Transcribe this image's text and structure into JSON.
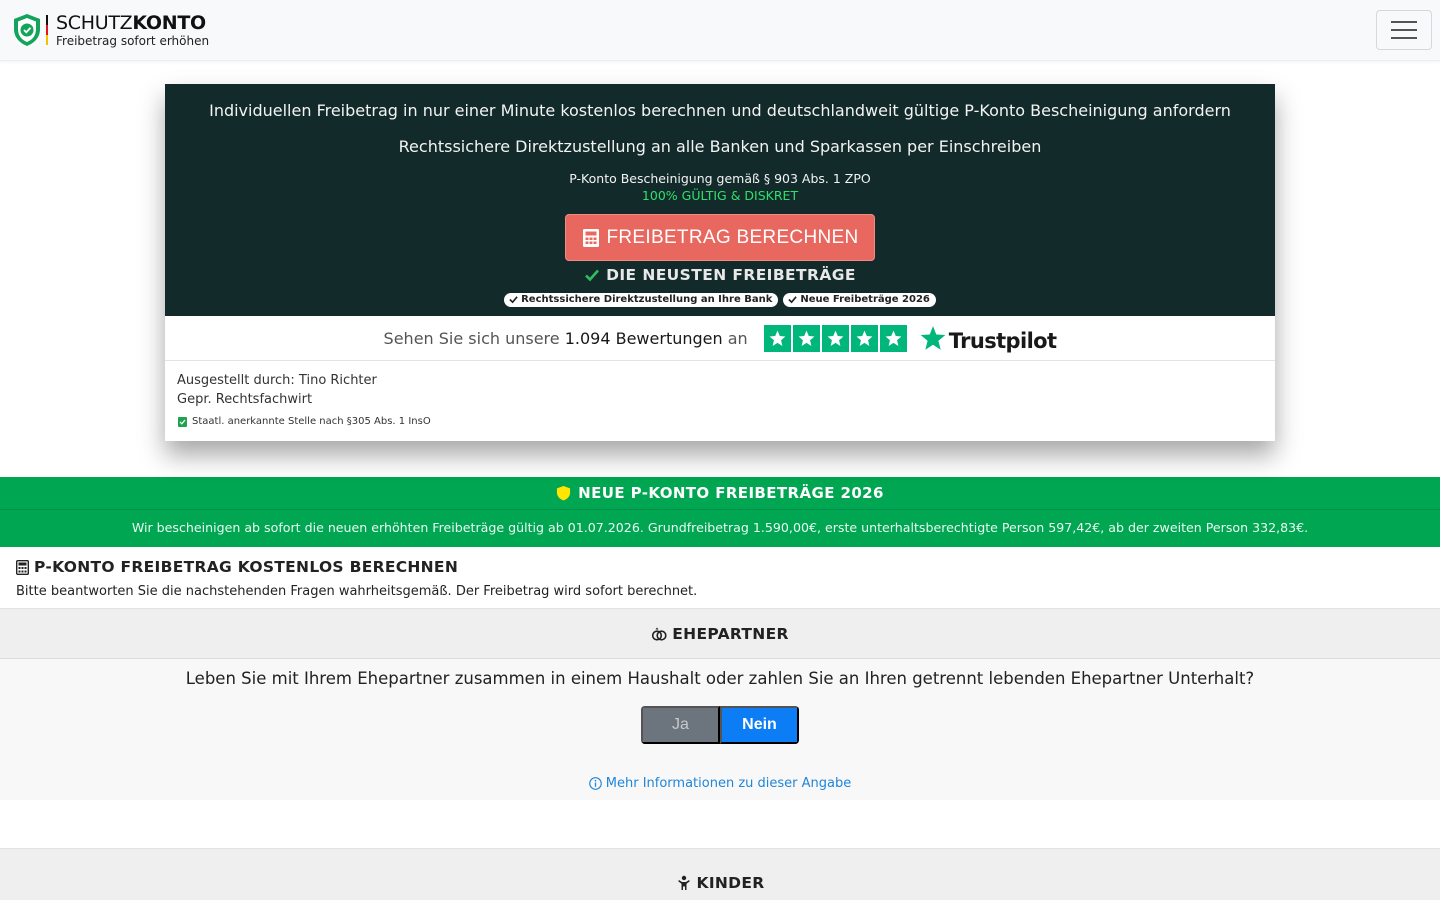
{
  "navbar": {
    "brand_name_regular": "SCHUTZ",
    "brand_name_bold": "KONTO",
    "brand_sub": "Freibetrag sofort erhöhen",
    "brand_icon": "shield-check-icon",
    "menu_icon": "hamburger-icon"
  },
  "hero": {
    "line1": "Individuellen Freibetrag in nur einer Minute kostenlos berechnen und deutschlandweit gültige P-Konto Bescheinigung anfordern",
    "line2": "Rechtssichere Direktzustellung an alle Banken und Sparkassen per Einschreiben",
    "small": "P-Konto Bescheinigung gemäß § 903 Abs. 1 ZPO",
    "green": "100% GÜLTIG & DISKRET",
    "button_label": "FREIBETRAG BERECHNEN",
    "neu_label": "DIE NEUSTEN FREIBETRÄGE",
    "badges": [
      "Rechtssichere Direktzustellung an Ihre Bank",
      "Neue Freibeträge 2026"
    ]
  },
  "trust": {
    "pre": "Sehen Sie sich unsere",
    "count": "1.094 Bewertungen",
    "post": "an",
    "logo": "Trustpilot",
    "stars": 5,
    "color": "#00b67a"
  },
  "issuer": {
    "line1": "Ausgestellt durch: Tino Richter",
    "line2": "Gepr. Rechtsfachwirt",
    "note": "Staatl. anerkannte Stelle nach §305 Abs. 1 InsO"
  },
  "banner": {
    "title": "NEUE P-KONTO FREIBETRÄGE 2026",
    "text": "Wir bescheinigen ab sofort die neuen erhöhten Freibeträge gültig ab 01.07.2026. Grundfreibetrag 1.590,00€, erste unterhaltsberechtigte Person 597,42€, ab der zweiten Person 332,83€.",
    "color": "#00a651"
  },
  "calc": {
    "title": "P-KONTO FREIBETRAG KOSTENLOS BERECHNEN",
    "text": "Bitte beantworten Sie die nachstehenden Fragen wahrheitsgemäß. Der Freibetrag wird sofort berechnet."
  },
  "sections": {
    "ehepartner": {
      "title": "EHEPARTNER",
      "question": "Leben Sie mit Ihrem Ehepartner zusammen in einem Haushalt oder zahlen Sie an Ihren getrennt lebenden Ehepartner Unterhalt?",
      "yes": "Ja",
      "no": "Nein",
      "selected": "Nein",
      "more_info": "Mehr Informationen zu dieser Angabe"
    },
    "kinder": {
      "title": "KINDER"
    }
  }
}
